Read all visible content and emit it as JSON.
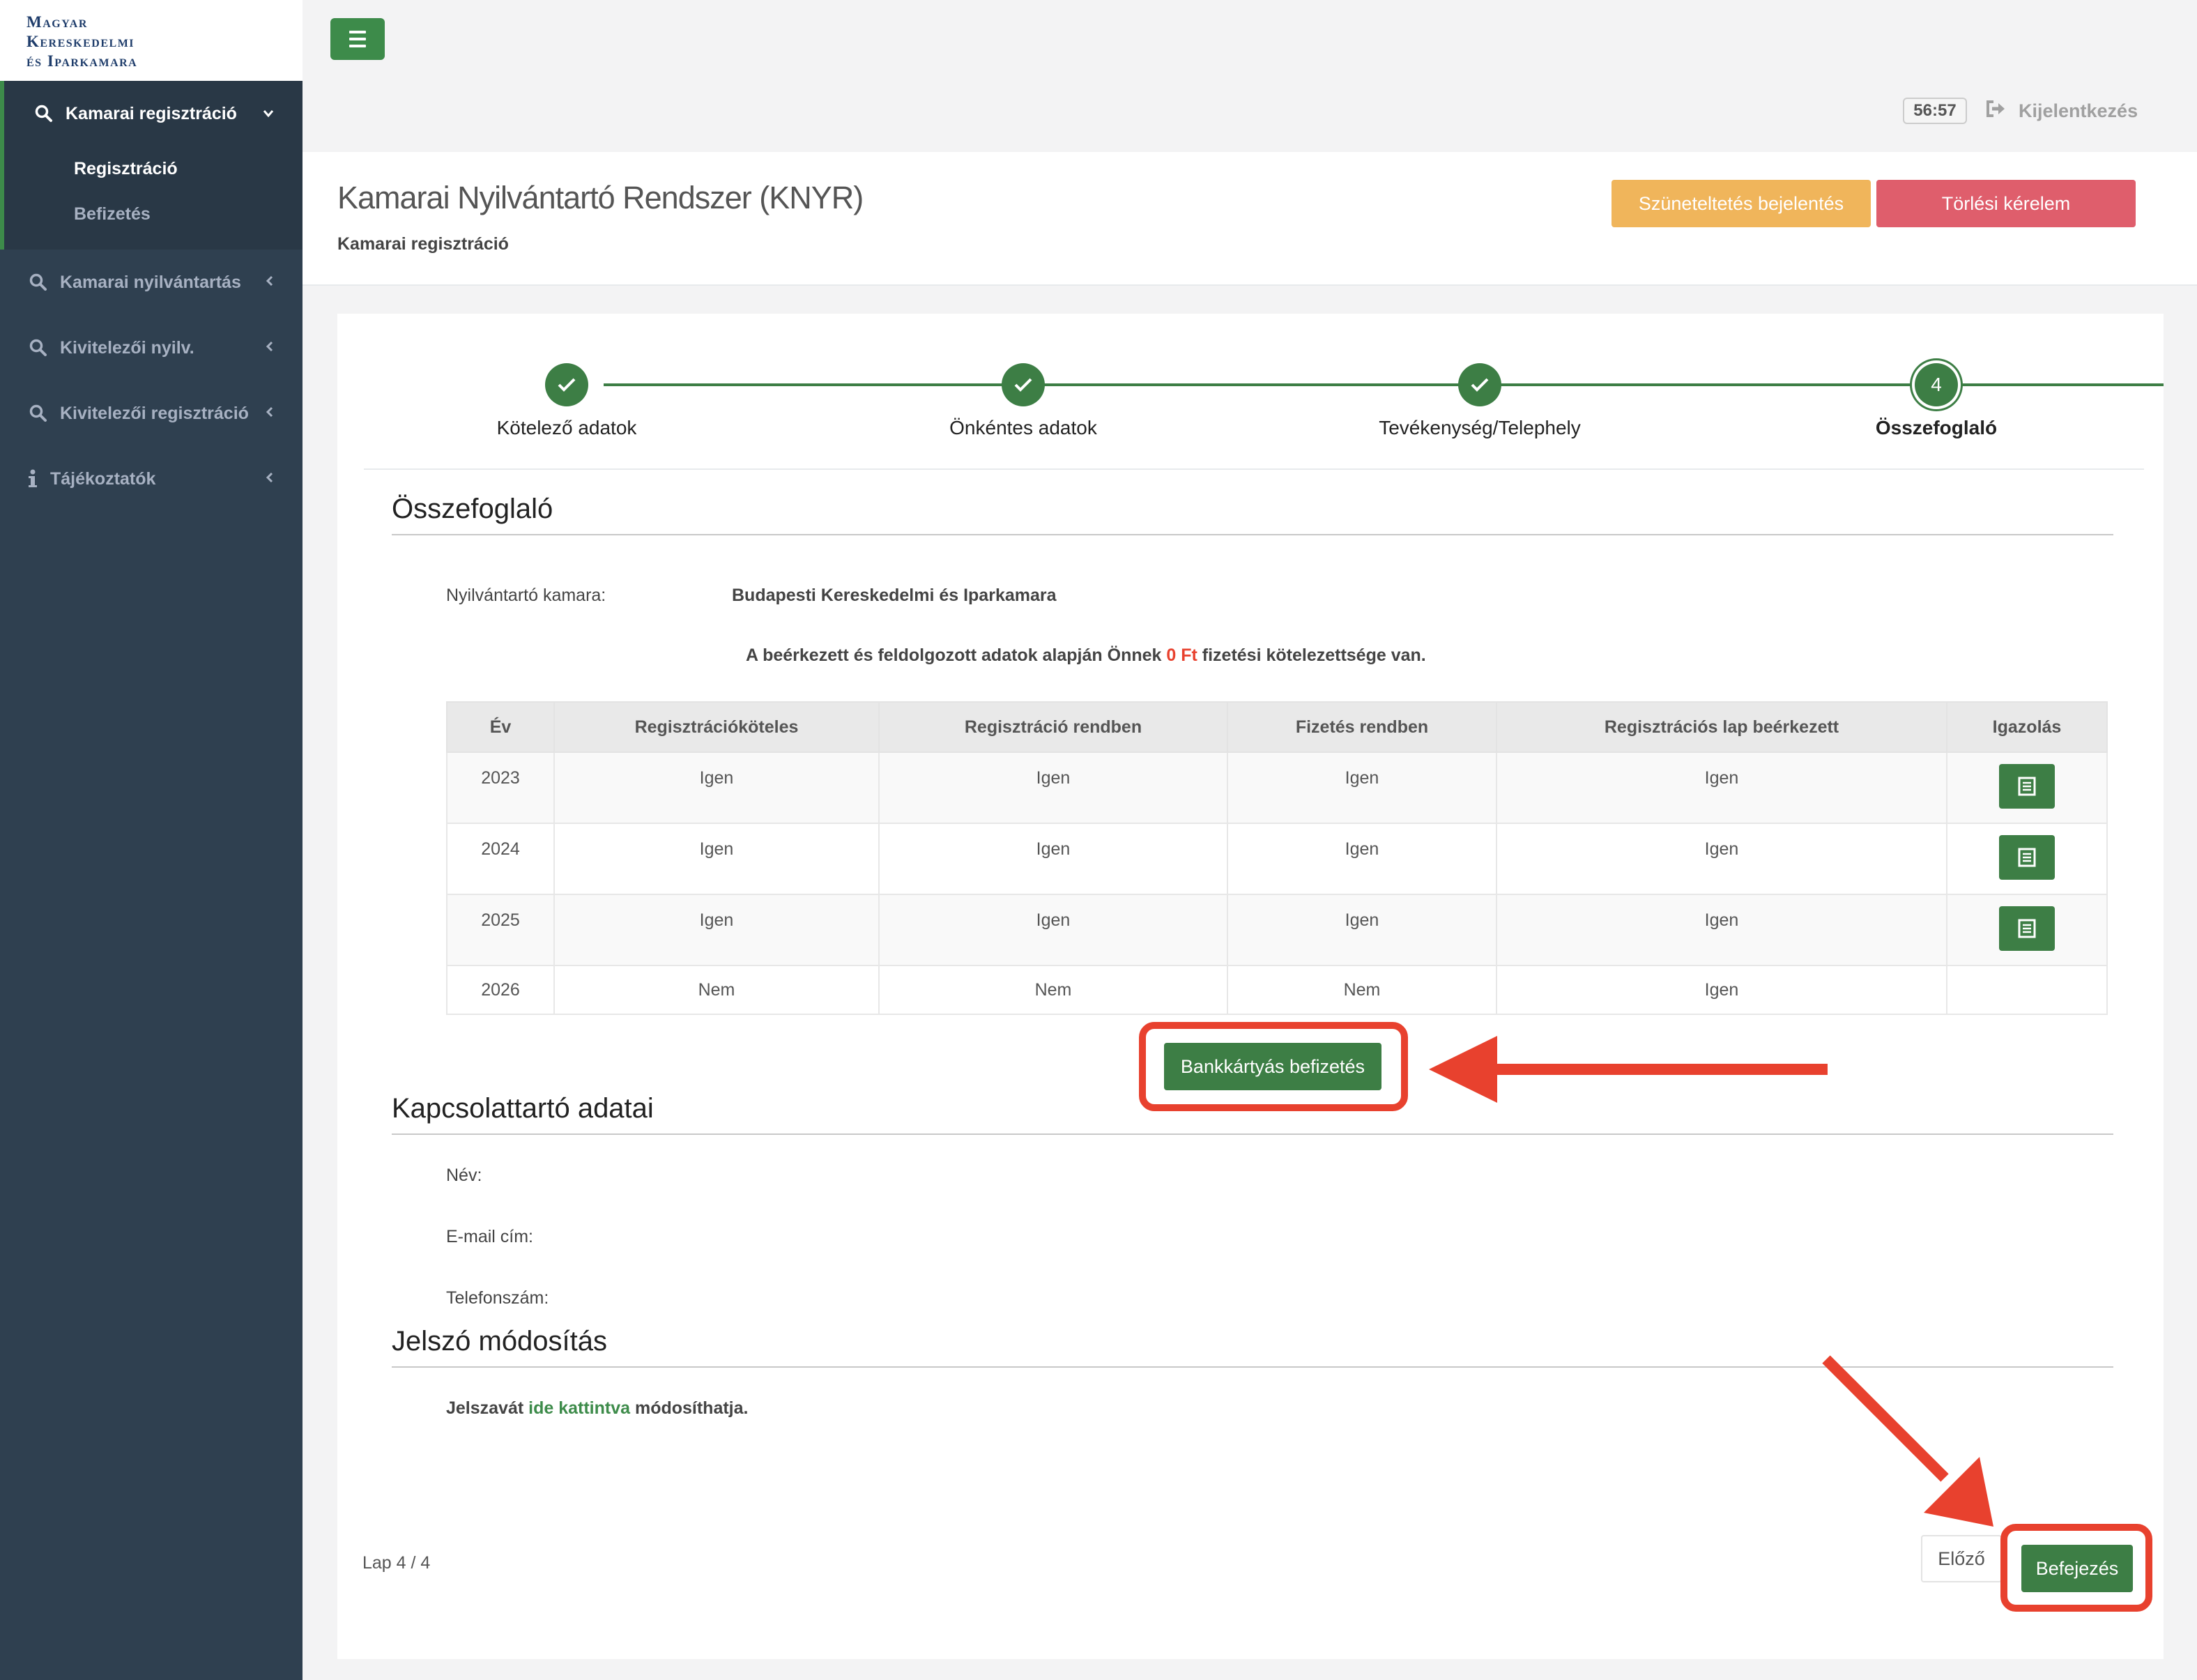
{
  "brand": {
    "logo_lines": [
      "Magyar",
      "Kereskedelmi",
      "és Iparkamara"
    ]
  },
  "sidebar": {
    "active_group": "Kamarai regisztráció",
    "subitems": [
      {
        "label": "Regisztráció",
        "active": true
      },
      {
        "label": "Befizetés",
        "active": false
      }
    ],
    "items": [
      {
        "label": "Kamarai nyilvántartás",
        "icon": "search-icon"
      },
      {
        "label": "Kivitelezői nyilv.",
        "icon": "search-icon"
      },
      {
        "label": "Kivitelezői regisztráció",
        "icon": "search-icon"
      },
      {
        "label": "Tájékoztatók",
        "icon": "info-icon"
      }
    ]
  },
  "topbar": {
    "timer": "56:57",
    "logout_label": "Kijelentkezés"
  },
  "header": {
    "title": "Kamarai Nyilvántartó Rendszer (KNYR)",
    "subtitle": "Kamarai regisztráció",
    "suspend_label": "Szüneteltetés bejelentés",
    "delete_label": "Törlési kérelem"
  },
  "wizard": {
    "steps": [
      {
        "label": "Kötelező adatok",
        "done": true
      },
      {
        "label": "Önkéntes adatok",
        "done": true
      },
      {
        "label": "Tevékenység/Telephely",
        "done": true
      },
      {
        "label": "Összefoglaló",
        "number": "4",
        "current": true
      }
    ]
  },
  "summary": {
    "title": "Összefoglaló",
    "chamber_label": "Nyilvántartó kamara:",
    "chamber_value": "Budapesti Kereskedelmi és Iparkamara",
    "notice_before": "A beérkezett és feldolgozott adatok alapján Önnek ",
    "notice_amount": "0 Ft",
    "notice_after": " fizetési kötelezettsége van.",
    "table": {
      "headers": [
        "Év",
        "Regisztrációköteles",
        "Regisztráció rendben",
        "Fizetés rendben",
        "Regisztrációs lap beérkezett",
        "Igazolás"
      ],
      "rows": [
        {
          "year": "2023",
          "c1": "Igen",
          "c2": "Igen",
          "c3": "Igen",
          "c4": "Igen",
          "doc": true
        },
        {
          "year": "2024",
          "c1": "Igen",
          "c2": "Igen",
          "c3": "Igen",
          "c4": "Igen",
          "doc": true
        },
        {
          "year": "2025",
          "c1": "Igen",
          "c2": "Igen",
          "c3": "Igen",
          "c4": "Igen",
          "doc": true
        },
        {
          "year": "2026",
          "c1": "Nem",
          "c2": "Nem",
          "c3": "Nem",
          "c4": "Igen",
          "doc": false
        }
      ]
    },
    "card_payment_label": "Bankkártyás befizetés"
  },
  "contact": {
    "title": "Kapcsolattartó adatai",
    "name_label": "Név:",
    "email_label": "E-mail cím:",
    "phone_label": "Telefonszám:"
  },
  "password": {
    "title": "Jelszó módosítás",
    "text_before": "Jelszavát ",
    "link_text": "ide kattintva",
    "text_after": " módosíthatja."
  },
  "footer": {
    "page_indicator": "Lap 4 / 4",
    "prev_label": "Előző",
    "finish_label": "Befejezés"
  },
  "colors": {
    "sidebar_bg": "#2f4050",
    "primary_green": "#3d7e45",
    "warning": "#f0b55b",
    "danger": "#df5e6c",
    "annotation_red": "#e8412e"
  }
}
